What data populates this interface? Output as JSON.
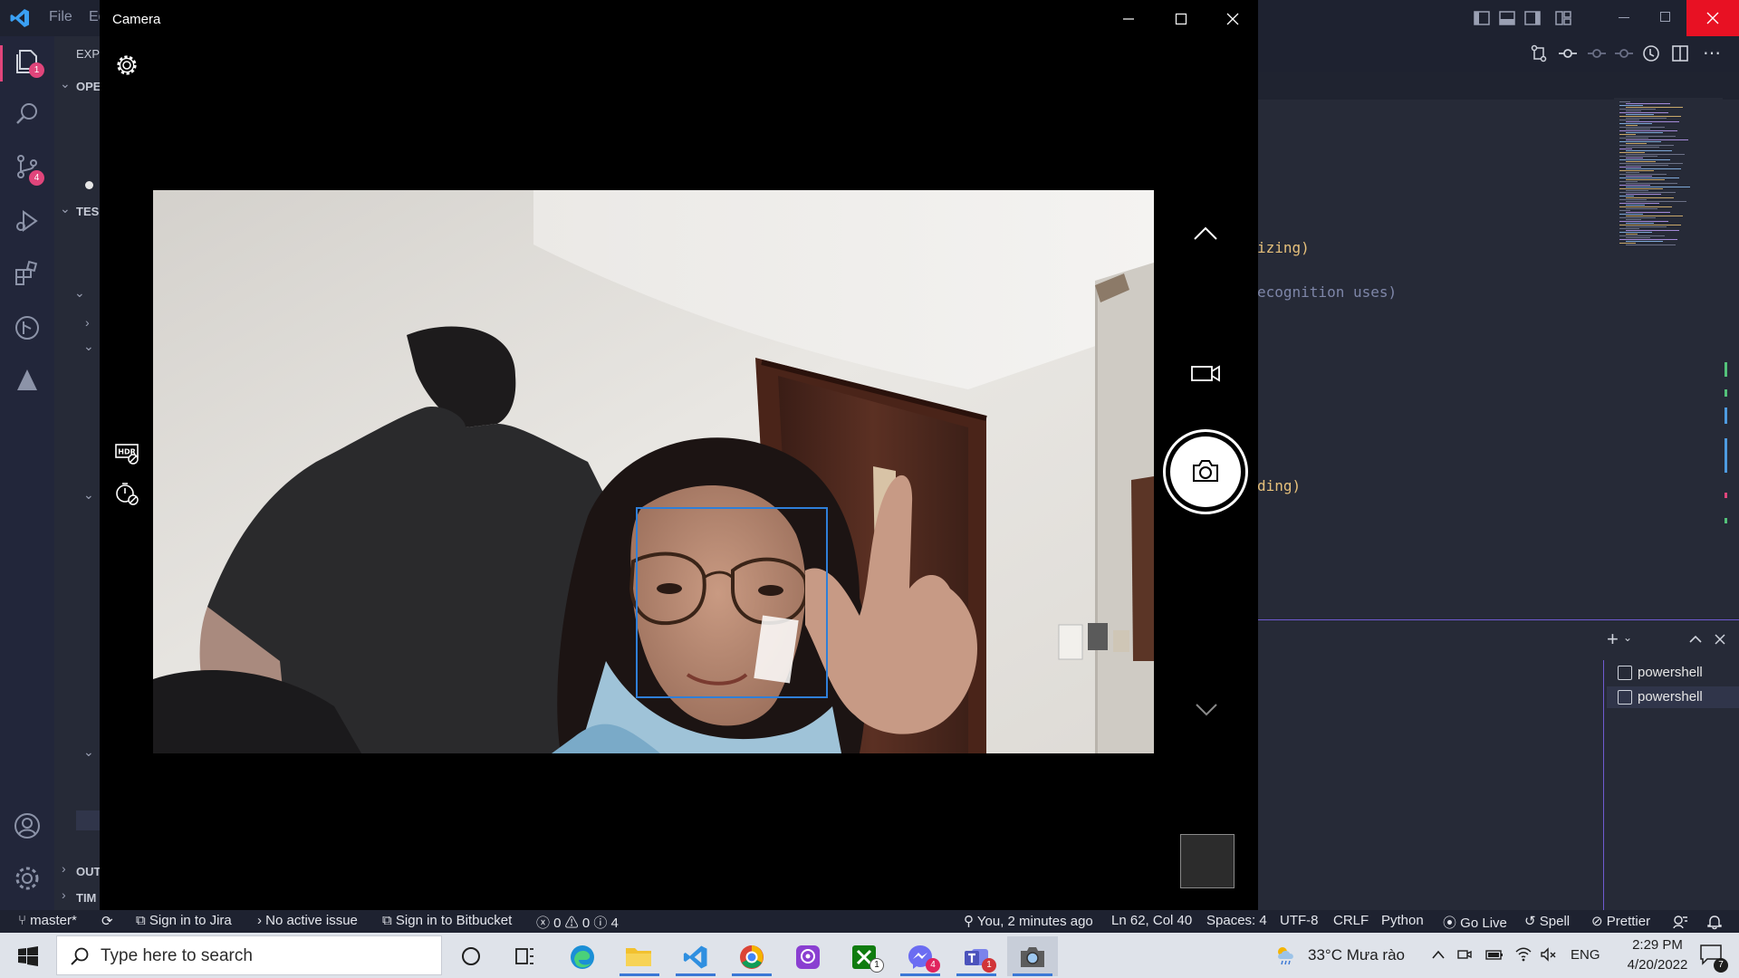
{
  "vscode": {
    "menu": [
      "File",
      "Ed"
    ],
    "activity_badges": {
      "explorer": "1",
      "source_control": "4"
    },
    "sidebar": {
      "explorer_header": "EXP",
      "open_editors": "OPE",
      "folder_header": "TES",
      "outline": "OUT",
      "timeline": "TIM"
    },
    "code_fragments": [
      {
        "text": "izing)",
        "color": "#e6c07b"
      },
      {
        "text": "ecognition uses)",
        "color": "#7e86a8"
      },
      {
        "text": "ding)",
        "color": "#e6c07b"
      }
    ],
    "terminal": {
      "items": [
        "powershell",
        "powershell"
      ]
    },
    "statusbar": {
      "branch": "master*",
      "jira": "Sign in to Jira",
      "issue": "No active issue",
      "bitbucket": "Sign in to Bitbucket",
      "errors": "0",
      "warnings": "0",
      "infos": "4",
      "blame": "You, 2 minutes ago",
      "position": "Ln 62, Col 40",
      "spaces": "Spaces: 4",
      "encoding": "UTF-8",
      "eol": "CRLF",
      "language": "Python",
      "golive": "Go Live",
      "spell": "Spell",
      "prettier": "Prettier"
    }
  },
  "camera": {
    "title": "Camera",
    "icons": {
      "settings": "gear-icon",
      "hdr": "hdr-icon",
      "timer": "timer-icon",
      "mode_up": "chevron-up-icon",
      "video_mode": "video-camera-icon",
      "shutter": "camera-icon",
      "mode_down": "chevron-down-icon"
    },
    "face_box_color": "#2f7fd8"
  },
  "taskbar": {
    "search_placeholder": "Type here to search",
    "weather": "33°C  Mưa rào",
    "language": "ENG",
    "time": "2:29 PM",
    "date": "4/20/2022",
    "notification_count": "7",
    "app_badges": {
      "xbox": "1",
      "messenger": "4",
      "teams": "1"
    }
  }
}
